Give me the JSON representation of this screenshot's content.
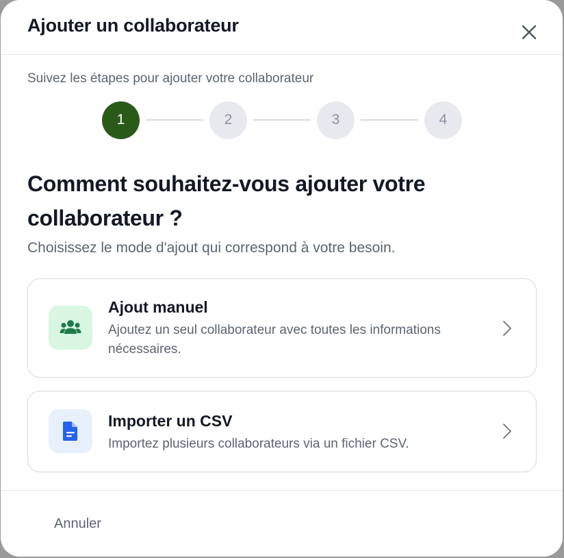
{
  "modal": {
    "title": "Ajouter un collaborateur",
    "close_icon": "close-icon"
  },
  "stepper": {
    "subtitle": "Suivez les étapes pour ajouter votre collaborateur",
    "current_step": 1,
    "steps": [
      "1",
      "2",
      "3",
      "4"
    ]
  },
  "content": {
    "question": "Comment souhaitez-vous ajouter votre collaborateur ?",
    "hint": "Choisissez le mode d'ajout qui correspond à votre besoin."
  },
  "options": [
    {
      "title": "Ajout manuel",
      "description": "Ajoutez un seul collaborateur avec toutes les informations nécessaires.",
      "icon": "users-group-icon",
      "accent": "#1f7a4a"
    },
    {
      "title": "Importer un CSV",
      "description": "Importez plusieurs collaborateurs via un fichier CSV.",
      "icon": "document-icon",
      "accent": "#2563eb"
    }
  ],
  "footer": {
    "cancel_label": "Annuler"
  },
  "colors": {
    "active_step": "#2a5a18",
    "inactive_step": "#e7e9ee"
  }
}
